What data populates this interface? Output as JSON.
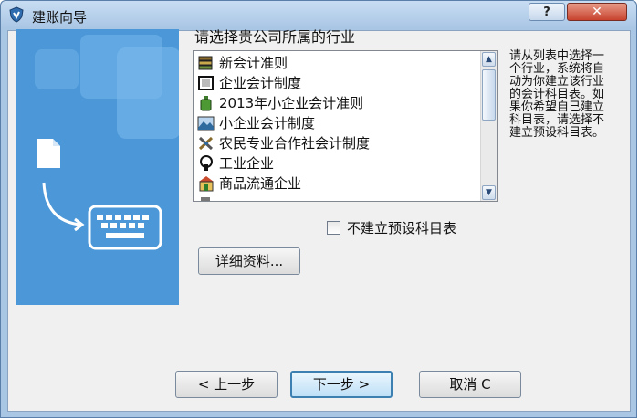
{
  "window": {
    "title": "建账向导",
    "help_label": "?",
    "close_label": "✕"
  },
  "heading": "请选择贵公司所属的行业",
  "industries": [
    {
      "label": "新会计准则",
      "icon": "ledger-stack-icon"
    },
    {
      "label": "企业会计制度",
      "icon": "frame-icon"
    },
    {
      "label": "2013年小企业会计准则",
      "icon": "bottle-icon"
    },
    {
      "label": "小企业会计制度",
      "icon": "landscape-icon"
    },
    {
      "label": "农民专业合作社会计制度",
      "icon": "tools-icon"
    },
    {
      "label": "工业企业",
      "icon": "factory-icon"
    },
    {
      "label": "商品流通企业",
      "icon": "shop-icon"
    },
    {
      "label": "",
      "icon": "partial-icon"
    }
  ],
  "help_text": "请从列表中选择一个行业，系统将自动为你建立该行业的会计科目表。如果你希望自己建立科目表，请选择不建立预设科目表。",
  "buttons": {
    "details": "详细资料...",
    "prev": "< 上一步",
    "next": "下一步 >",
    "cancel": "取消 C"
  },
  "checkbox": {
    "label": "不建立预设科目表",
    "checked": false
  },
  "colors": {
    "titlebar": "#a9c6e5",
    "art_panel": "#4b97d8",
    "default_button_border": "#3c7fb1",
    "close_button": "#c8432e"
  }
}
